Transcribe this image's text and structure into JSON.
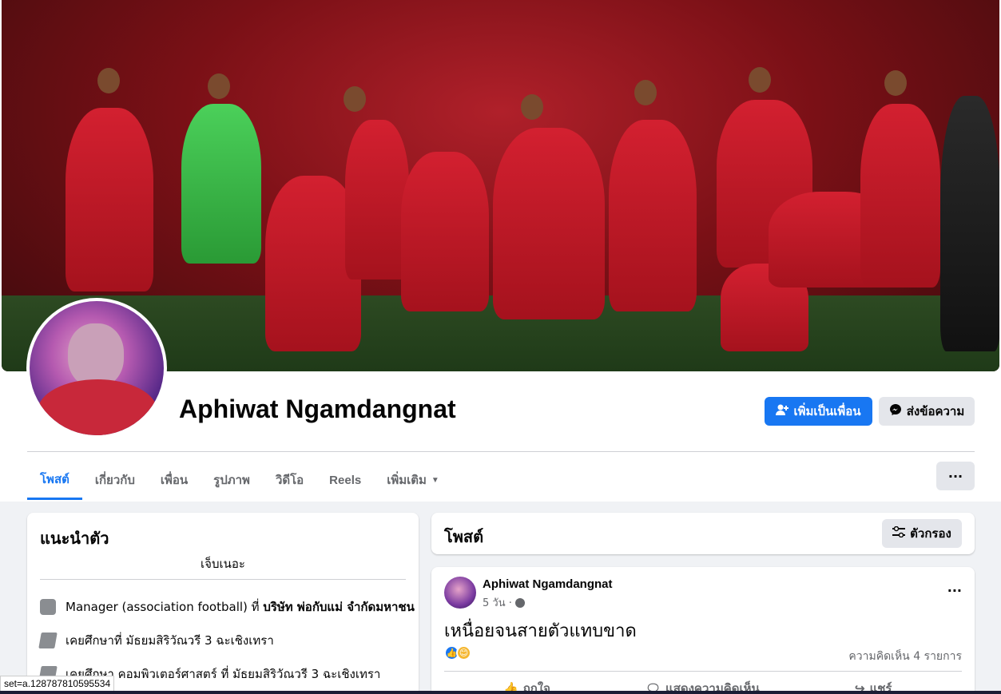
{
  "profile": {
    "name": "Aphiwat Ngamdangnat",
    "add_friend_label": "เพิ่มเป็นเพื่อน",
    "message_label": "ส่งข้อความ"
  },
  "tabs": [
    {
      "label": "โพสต์",
      "active": true
    },
    {
      "label": "เกี่ยวกับ"
    },
    {
      "label": "เพื่อน"
    },
    {
      "label": "รูปภาพ"
    },
    {
      "label": "วิดีโอ"
    },
    {
      "label": "Reels"
    },
    {
      "label": "เพิ่มเติม"
    }
  ],
  "more_button": "···",
  "intro": {
    "title": "แนะนำตัว",
    "bio": "เจ็บเนอะ",
    "work_prefix": "Manager (association football) ที่",
    "work_company": "บริษัท พ่อกับแม่ จำกัดมหาชน",
    "edu1": "เคยศึกษาที่ มัธยมสิริวัณวรี 3 ฉะเชิงเทรา",
    "edu2": "เคยศึกษา คอมพิวเตอร์ศาสตร์ ที่ มัธยมสิริวัณวรี 3 ฉะเชิงเทรา"
  },
  "posts": {
    "title": "โพสต์",
    "filter_label": "ตัวกรอง"
  },
  "post": {
    "author": "Aphiwat Ngamdangnat",
    "time": "5 วัน ·",
    "text": "เหนื่อยจนสายตัวแทบขาด",
    "comment_count": "ความคิดเห็น 4 รายการ",
    "like_label": "ถูกใจ",
    "comment_label": "แสดงความคิดเห็น",
    "share_label": "แชร์"
  },
  "status_url": "set=a.128787810595534",
  "colors": {
    "accent": "#1877f2",
    "bg": "#f0f2f5"
  }
}
